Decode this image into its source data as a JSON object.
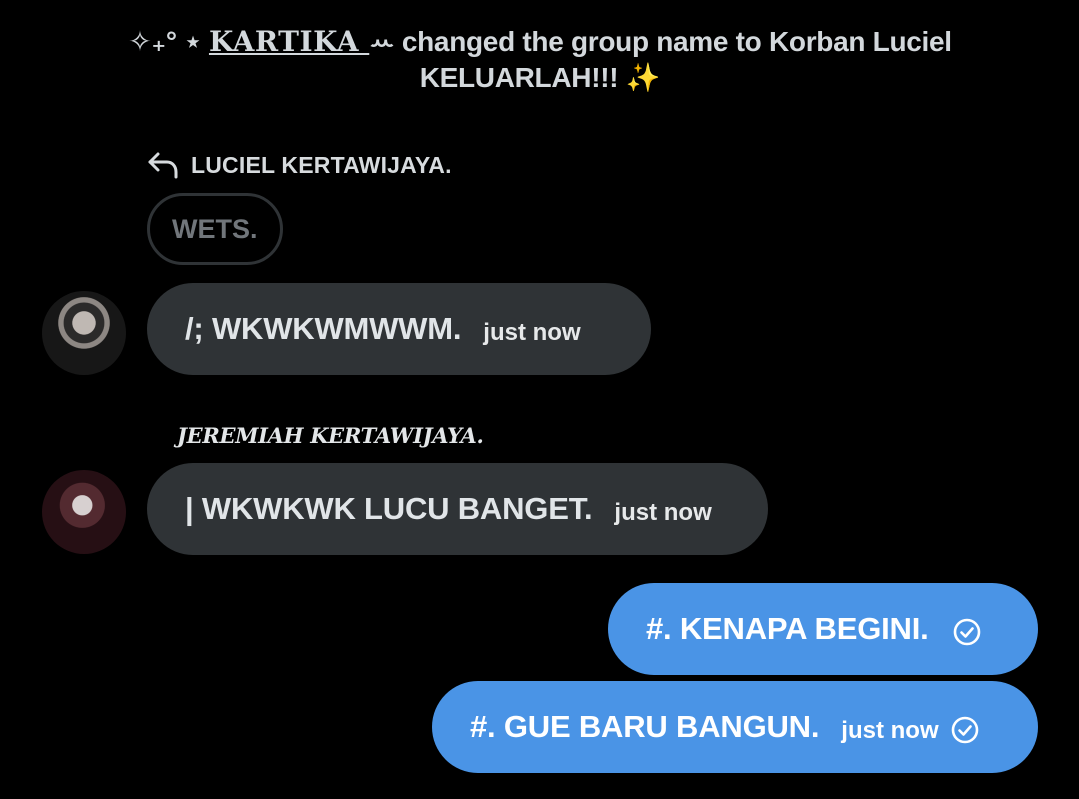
{
  "system_notice": {
    "decor_prefix": "✧₊° ⋆ ",
    "actor_name": "KARTIKA ",
    "actor_suffix": "ꕀ",
    "message": " changed the group name to Korban Luciel KELUARLAH!!! ✨"
  },
  "reply": {
    "icon": "reply-arrow-icon",
    "name": "LUCIEL KERTAWIJAYA.",
    "quoted_text": "WETS."
  },
  "messages": [
    {
      "direction": "incoming",
      "text": "/; WKWKWMWWM.",
      "time": "just now",
      "avatar": "avatar"
    },
    {
      "direction": "incoming",
      "sender": "JEREMIAH KERTAWIJAYA.",
      "text": "| WKWKWK LUCU BANGET.",
      "time": "just now",
      "avatar": "avatar"
    },
    {
      "direction": "outgoing",
      "text": "#. KENAPA BEGINI.",
      "time": "",
      "status_icon": "check-circle-icon"
    },
    {
      "direction": "outgoing",
      "text": "#. GUE BARU BANGUN.",
      "time": "just now",
      "status_icon": "check-circle-icon"
    }
  ],
  "colors": {
    "background": "#000000",
    "incoming_bubble": "#2f3336",
    "outgoing_bubble": "#4a94e6",
    "quoted_border": "#2f3336",
    "quoted_text": "#71767b"
  }
}
